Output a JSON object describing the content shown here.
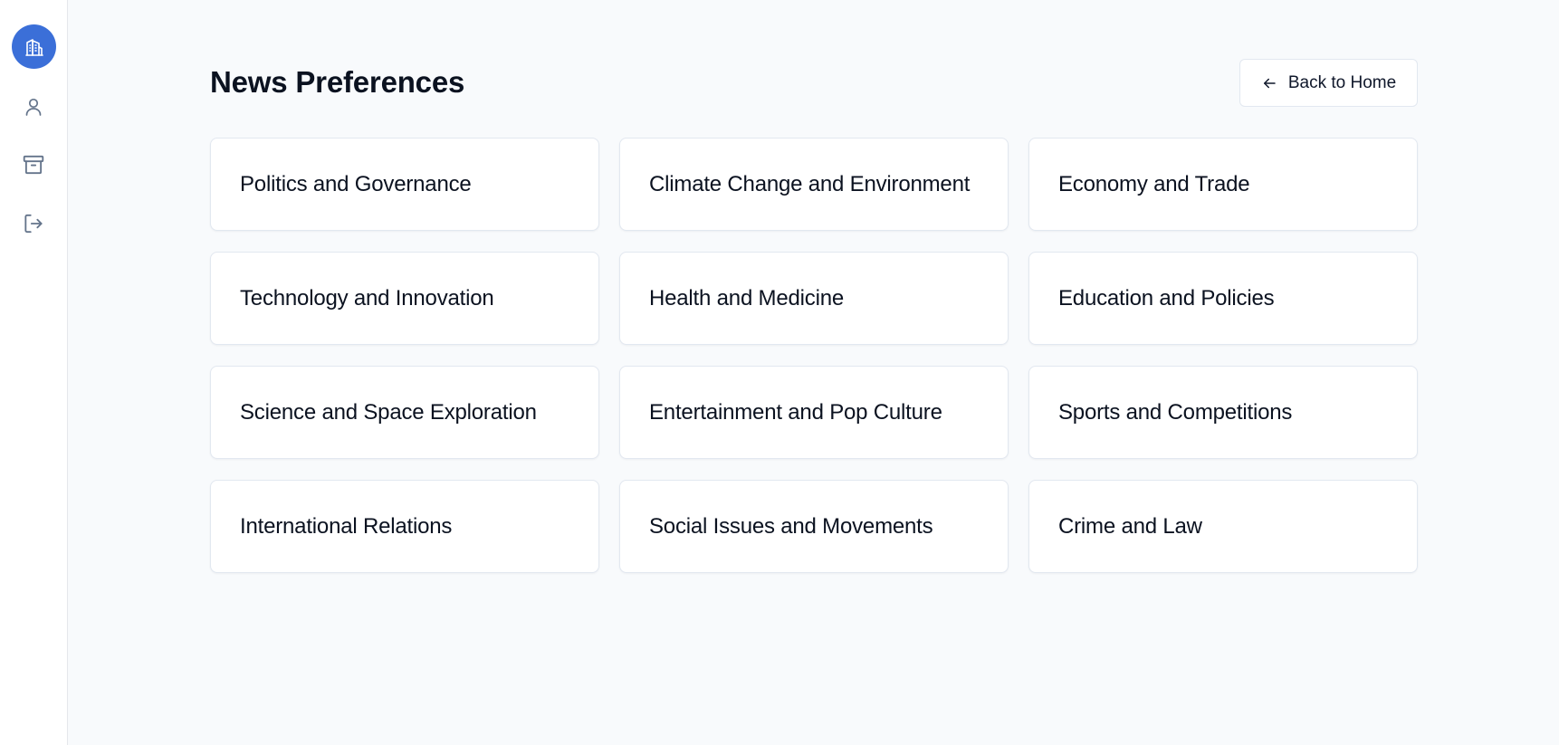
{
  "sidebar": {
    "items": [
      {
        "name": "user-icon",
        "label": "Profile"
      },
      {
        "name": "archive-icon",
        "label": "Archive"
      },
      {
        "name": "logout-icon",
        "label": "Logout"
      }
    ],
    "logo_icon": "building-icon",
    "logo_color": "#3b6fd8"
  },
  "header": {
    "title": "News Preferences",
    "back_label": "Back to Home",
    "back_icon": "arrow-left-icon"
  },
  "categories": [
    "Politics and Governance",
    "Climate Change and Environment",
    "Economy and Trade",
    "Technology and Innovation",
    "Health and Medicine",
    "Education and Policies",
    "Science and Space Exploration",
    "Entertainment and Pop Culture",
    "Sports and Competitions",
    "International Relations",
    "Social Issues and Movements",
    "Crime and Law"
  ]
}
